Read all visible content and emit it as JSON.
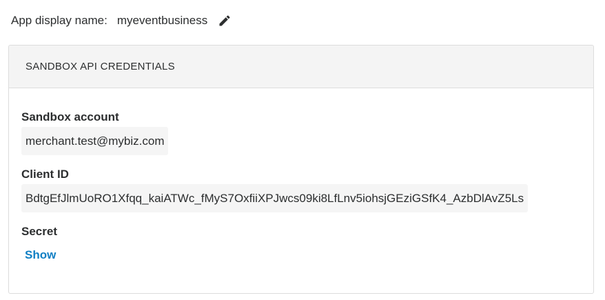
{
  "app": {
    "display_name_label": "App display name:",
    "display_name_value": "myeventbusiness",
    "edit_icon": "pencil-icon"
  },
  "credentials": {
    "header": "SANDBOX API CREDENTIALS",
    "sandbox_account_label": "Sandbox account",
    "sandbox_account_value": "merchant.test@mybiz.com",
    "client_id_label": "Client ID",
    "client_id_value": "BdtgEfJlmUoRO1Xfqq_kaiATWc_fMyS7OxfiiXPJwcs09ki8LfLnv5iohsjGEziGSfK4_AzbDlAvZ5Ls",
    "secret_label": "Secret",
    "secret_show_link": "Show"
  },
  "colors": {
    "link": "#0f7fc4",
    "header_bg": "#f4f4f4",
    "value_bg": "#f5f5f5",
    "border": "#dcdcdc"
  }
}
